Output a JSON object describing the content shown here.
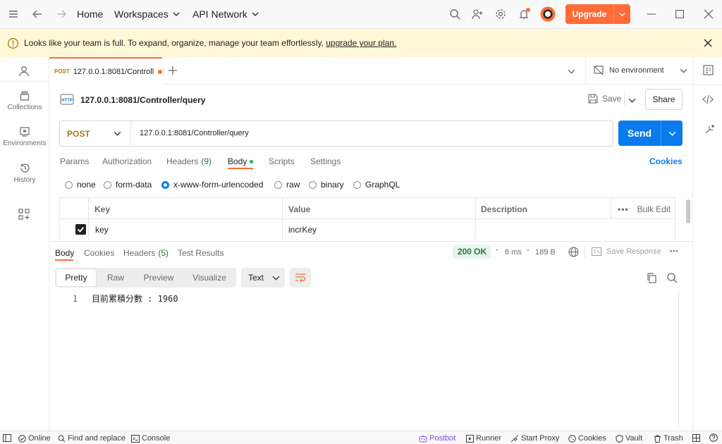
{
  "titlebar": {
    "home": "Home",
    "workspaces": "Workspaces",
    "api_network": "API Network",
    "upgrade": "Upgrade"
  },
  "banner": {
    "message": "Looks like your team is full. To expand, organize, manage your team effortlessly,",
    "link": "upgrade your plan."
  },
  "sidebar": {
    "items": [
      {
        "label": "Collections",
        "icon": "collections-icon"
      },
      {
        "label": "Environments",
        "icon": "environments-icon"
      },
      {
        "label": "History",
        "icon": "history-icon"
      }
    ]
  },
  "tabs": {
    "active": {
      "method": "POST",
      "label": "127.0.0.1:8081/Controll"
    },
    "environment": "No environment"
  },
  "request": {
    "badge": "HTTP",
    "title": "127.0.0.1:8081/Controller/query",
    "save": "Save",
    "share": "Share",
    "method": "POST",
    "url": "127.0.0.1:8081/Controller/query",
    "send": "Send",
    "tabs": {
      "params": "Params",
      "authorization": "Authorization",
      "headers": "Headers",
      "headers_count": "(9)",
      "body": "Body",
      "scripts": "Scripts",
      "settings": "Settings",
      "cookies": "Cookies"
    },
    "body_types": [
      "none",
      "form-data",
      "x-www-form-urlencoded",
      "raw",
      "binary",
      "GraphQL"
    ],
    "body_type_selected": "x-www-form-urlencoded",
    "table": {
      "headers": {
        "key": "Key",
        "value": "Value",
        "description": "Description",
        "bulk_edit": "Bulk Edit"
      },
      "rows": [
        {
          "checked": true,
          "key": "key",
          "value": "incrKey",
          "description": ""
        }
      ]
    }
  },
  "response": {
    "tabs": {
      "body": "Body",
      "cookies": "Cookies",
      "headers": "Headers",
      "headers_count": "(5)",
      "test_results": "Test Results"
    },
    "status": "200 OK",
    "time": "6 ms",
    "size": "189 B",
    "save_response": "Save Response",
    "views": [
      "Pretty",
      "Raw",
      "Preview",
      "Visualize"
    ],
    "view_selected": "Pretty",
    "format": "Text",
    "lines": [
      {
        "num": "1",
        "text": "目前累積分數 : 1960"
      }
    ]
  },
  "statusbar": {
    "online": "Online",
    "find_replace": "Find and replace",
    "console": "Console",
    "postbot": "Postbot",
    "runner": "Runner",
    "start_proxy": "Start Proxy",
    "cookies": "Cookies",
    "vault": "Vault",
    "trash": "Trash"
  },
  "colors": {
    "accent": "#ff6c37",
    "send": "#097bed",
    "banner": "#fff7d6",
    "ok": "#1b7c36"
  }
}
